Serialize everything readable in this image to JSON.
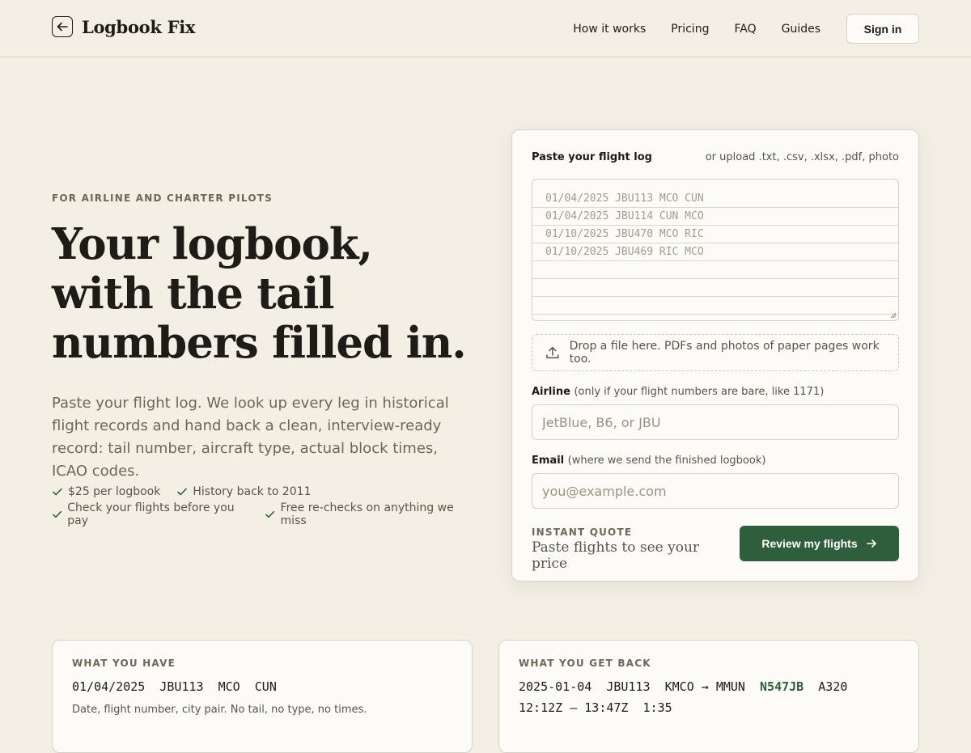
{
  "header": {
    "brand": "Logbook Fix",
    "nav": [
      "How it works",
      "Pricing",
      "FAQ",
      "Guides"
    ],
    "signin": "Sign in"
  },
  "hero": {
    "eyebrow": "FOR AIRLINE AND CHARTER PILOTS",
    "title": "Your logbook, with the tail numbers filled in.",
    "subtitle": "Paste your flight log. We look up every leg in historical flight records and hand back a clean, interview-ready record: tail number, aircraft type, actual block times, ICAO codes.",
    "checks": [
      "$25 per logbook",
      "History back to 2011",
      "Check your flights before you pay",
      "Free re-checks on anything we miss"
    ]
  },
  "form": {
    "log_label": "Paste your flight log",
    "upload_note": "or upload .txt, .csv, .xlsx, .pdf, photo",
    "log_placeholder_lines": [
      "01/04/2025 JBU113 MCO CUN",
      "01/04/2025 JBU114 CUN MCO",
      "01/10/2025 JBU470 MCO RIC",
      "01/10/2025 JBU469 RIC MCO"
    ],
    "drop_text": "Drop a file here. PDFs and photos of paper pages work too.",
    "airline_label": "Airline",
    "airline_note": "(only if your flight numbers are bare, like 1171)",
    "airline_placeholder": "JetBlue, B6, or JBU",
    "email_label": "Email",
    "email_note": "(where we send the finished logbook)",
    "email_placeholder": "you@example.com",
    "quote_label": "INSTANT QUOTE",
    "quote_text": "Paste flights to see your price",
    "submit": "Review my flights"
  },
  "compare": {
    "have": {
      "label": "WHAT YOU HAVE",
      "line": "01/04/2025  JBU113  MCO  CUN",
      "note": "Date, flight number, city pair. No tail, no type, no times."
    },
    "get": {
      "label": "WHAT YOU GET BACK",
      "line1_pre": "2025-01-04  JBU113  KMCO → MMUN  ",
      "tail": "N547JB",
      "line1_post": "  A320",
      "line2": "12:12Z – 13:47Z  1:35"
    }
  },
  "colors": {
    "background": "#f3efe5",
    "card": "#fdfbf7",
    "accent_green": "#2f5e3c",
    "border": "#d8d2c4",
    "muted_text": "#6e6659"
  },
  "icons": {
    "back": "arrow-left-icon",
    "check": "check-icon",
    "upload": "upload-icon",
    "submit": "arrow-right-icon"
  }
}
